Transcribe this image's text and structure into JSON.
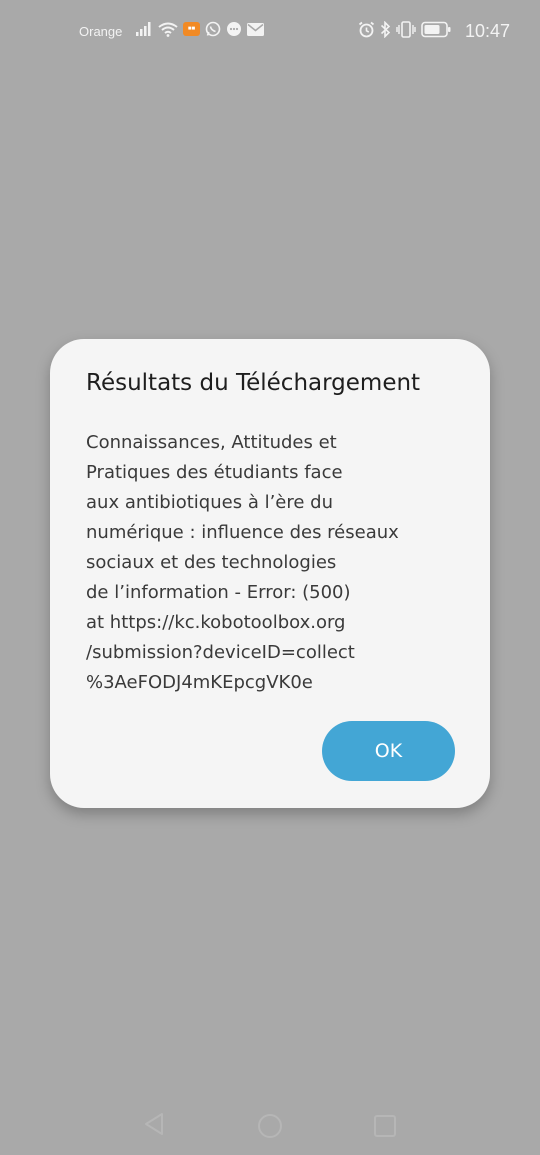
{
  "status_bar": {
    "carrier": "Orange",
    "time": "10:47",
    "left_icons": [
      "signal-icon",
      "wifi-icon",
      "notification-app-icon",
      "whatsapp-icon",
      "messages-icon",
      "mail-icon"
    ],
    "right_icons": [
      "alarm-icon",
      "bluetooth-icon",
      "vibrate-icon",
      "battery-icon"
    ]
  },
  "dialog": {
    "title": "Résultats du Téléchargement",
    "message_lines": [
      "Connaissances, Attitudes et",
      "Pratiques des étudiants face",
      "aux antibiotiques à l’ère du",
      "numérique : influence des réseaux",
      "sociaux et des technologies",
      "de l’information - Error:  (500)",
      "at https://kc.kobotoolbox.org",
      "/submission?deviceID=collect",
      "%3AeFODJ4mKEpcgVK0e"
    ],
    "ok_label": "OK"
  },
  "nav_bar": {
    "buttons": [
      "back-icon",
      "home-icon",
      "recent-apps-icon"
    ]
  },
  "colors": {
    "overlay_background": "#a9a9a9",
    "dialog_background": "#f5f5f5",
    "accent": "#43a6d5"
  }
}
